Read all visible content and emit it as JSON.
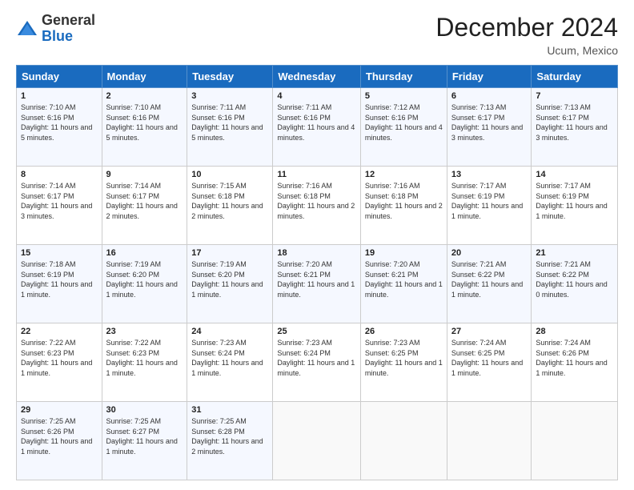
{
  "logo": {
    "general": "General",
    "blue": "Blue"
  },
  "header": {
    "month": "December 2024",
    "location": "Ucum, Mexico"
  },
  "days_of_week": [
    "Sunday",
    "Monday",
    "Tuesday",
    "Wednesday",
    "Thursday",
    "Friday",
    "Saturday"
  ],
  "weeks": [
    [
      {
        "day": "1",
        "info": "Sunrise: 7:10 AM\nSunset: 6:16 PM\nDaylight: 11 hours and 5 minutes."
      },
      {
        "day": "2",
        "info": "Sunrise: 7:10 AM\nSunset: 6:16 PM\nDaylight: 11 hours and 5 minutes."
      },
      {
        "day": "3",
        "info": "Sunrise: 7:11 AM\nSunset: 6:16 PM\nDaylight: 11 hours and 5 minutes."
      },
      {
        "day": "4",
        "info": "Sunrise: 7:11 AM\nSunset: 6:16 PM\nDaylight: 11 hours and 4 minutes."
      },
      {
        "day": "5",
        "info": "Sunrise: 7:12 AM\nSunset: 6:16 PM\nDaylight: 11 hours and 4 minutes."
      },
      {
        "day": "6",
        "info": "Sunrise: 7:13 AM\nSunset: 6:17 PM\nDaylight: 11 hours and 3 minutes."
      },
      {
        "day": "7",
        "info": "Sunrise: 7:13 AM\nSunset: 6:17 PM\nDaylight: 11 hours and 3 minutes."
      }
    ],
    [
      {
        "day": "8",
        "info": "Sunrise: 7:14 AM\nSunset: 6:17 PM\nDaylight: 11 hours and 3 minutes."
      },
      {
        "day": "9",
        "info": "Sunrise: 7:14 AM\nSunset: 6:17 PM\nDaylight: 11 hours and 2 minutes."
      },
      {
        "day": "10",
        "info": "Sunrise: 7:15 AM\nSunset: 6:18 PM\nDaylight: 11 hours and 2 minutes."
      },
      {
        "day": "11",
        "info": "Sunrise: 7:16 AM\nSunset: 6:18 PM\nDaylight: 11 hours and 2 minutes."
      },
      {
        "day": "12",
        "info": "Sunrise: 7:16 AM\nSunset: 6:18 PM\nDaylight: 11 hours and 2 minutes."
      },
      {
        "day": "13",
        "info": "Sunrise: 7:17 AM\nSunset: 6:19 PM\nDaylight: 11 hours and 1 minute."
      },
      {
        "day": "14",
        "info": "Sunrise: 7:17 AM\nSunset: 6:19 PM\nDaylight: 11 hours and 1 minute."
      }
    ],
    [
      {
        "day": "15",
        "info": "Sunrise: 7:18 AM\nSunset: 6:19 PM\nDaylight: 11 hours and 1 minute."
      },
      {
        "day": "16",
        "info": "Sunrise: 7:19 AM\nSunset: 6:20 PM\nDaylight: 11 hours and 1 minute."
      },
      {
        "day": "17",
        "info": "Sunrise: 7:19 AM\nSunset: 6:20 PM\nDaylight: 11 hours and 1 minute."
      },
      {
        "day": "18",
        "info": "Sunrise: 7:20 AM\nSunset: 6:21 PM\nDaylight: 11 hours and 1 minute."
      },
      {
        "day": "19",
        "info": "Sunrise: 7:20 AM\nSunset: 6:21 PM\nDaylight: 11 hours and 1 minute."
      },
      {
        "day": "20",
        "info": "Sunrise: 7:21 AM\nSunset: 6:22 PM\nDaylight: 11 hours and 1 minute."
      },
      {
        "day": "21",
        "info": "Sunrise: 7:21 AM\nSunset: 6:22 PM\nDaylight: 11 hours and 0 minutes."
      }
    ],
    [
      {
        "day": "22",
        "info": "Sunrise: 7:22 AM\nSunset: 6:23 PM\nDaylight: 11 hours and 1 minute."
      },
      {
        "day": "23",
        "info": "Sunrise: 7:22 AM\nSunset: 6:23 PM\nDaylight: 11 hours and 1 minute."
      },
      {
        "day": "24",
        "info": "Sunrise: 7:23 AM\nSunset: 6:24 PM\nDaylight: 11 hours and 1 minute."
      },
      {
        "day": "25",
        "info": "Sunrise: 7:23 AM\nSunset: 6:24 PM\nDaylight: 11 hours and 1 minute."
      },
      {
        "day": "26",
        "info": "Sunrise: 7:23 AM\nSunset: 6:25 PM\nDaylight: 11 hours and 1 minute."
      },
      {
        "day": "27",
        "info": "Sunrise: 7:24 AM\nSunset: 6:25 PM\nDaylight: 11 hours and 1 minute."
      },
      {
        "day": "28",
        "info": "Sunrise: 7:24 AM\nSunset: 6:26 PM\nDaylight: 11 hours and 1 minute."
      }
    ],
    [
      {
        "day": "29",
        "info": "Sunrise: 7:25 AM\nSunset: 6:26 PM\nDaylight: 11 hours and 1 minute."
      },
      {
        "day": "30",
        "info": "Sunrise: 7:25 AM\nSunset: 6:27 PM\nDaylight: 11 hours and 1 minute."
      },
      {
        "day": "31",
        "info": "Sunrise: 7:25 AM\nSunset: 6:28 PM\nDaylight: 11 hours and 2 minutes."
      },
      {
        "day": "",
        "info": ""
      },
      {
        "day": "",
        "info": ""
      },
      {
        "day": "",
        "info": ""
      },
      {
        "day": "",
        "info": ""
      }
    ]
  ]
}
